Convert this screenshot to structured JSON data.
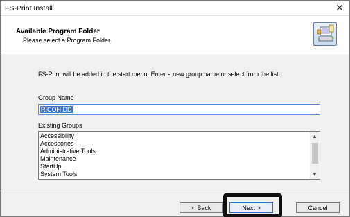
{
  "window": {
    "title": "FS-Print Install",
    "close_glyph": "✕"
  },
  "header": {
    "title": "Available Program Folder",
    "subtitle": "Please select a Program Folder.",
    "icon": "installer-computer-icon"
  },
  "body": {
    "intro": "FS-Print will be added in the start menu. Enter a new group name  or select from the list.",
    "group_name_label": "Group Name",
    "group_name_value": "RICOH DD",
    "existing_groups_label": "Existing Groups",
    "existing_groups": [
      "Accessibility",
      "Accessories",
      "Administrative Tools",
      "Maintenance",
      "StartUp",
      "System Tools"
    ]
  },
  "buttons": {
    "back": "< Back",
    "next": "Next >",
    "cancel": "Cancel"
  },
  "colors": {
    "selection": "#3a77cc",
    "highlight_box": "#111111"
  }
}
